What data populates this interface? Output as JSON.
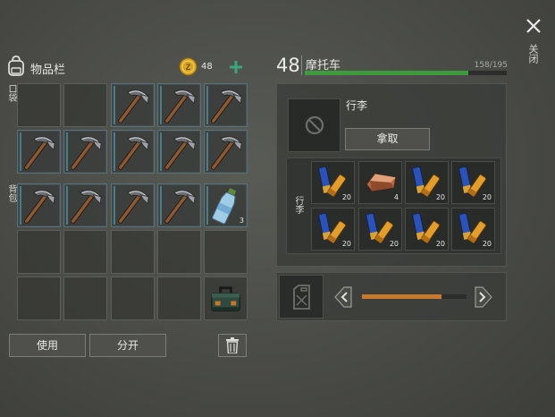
{
  "close": {
    "label": "关闭"
  },
  "inventory": {
    "title": "物品栏",
    "coins": "48",
    "pocket_label": "口袋",
    "backpack_label": "背包",
    "pocket_slots": [
      "",
      "",
      "pickaxe",
      "pickaxe",
      "pickaxe"
    ],
    "backpack_slots": [
      {
        "item": "pickaxe",
        "count": ""
      },
      {
        "item": "pickaxe",
        "count": ""
      },
      {
        "item": "pickaxe",
        "count": ""
      },
      {
        "item": "pickaxe",
        "count": ""
      },
      {
        "item": "pickaxe",
        "count": ""
      },
      {
        "item": "pickaxe",
        "count": ""
      },
      {
        "item": "pickaxe",
        "count": ""
      },
      {
        "item": "pickaxe",
        "count": ""
      },
      {
        "item": "pickaxe",
        "count": ""
      },
      {
        "item": "water-bottle",
        "count": "3"
      },
      {
        "item": "",
        "count": ""
      },
      {
        "item": "",
        "count": ""
      },
      {
        "item": "",
        "count": ""
      },
      {
        "item": "",
        "count": ""
      },
      {
        "item": "",
        "count": ""
      },
      {
        "item": "",
        "count": ""
      },
      {
        "item": "",
        "count": ""
      },
      {
        "item": "",
        "count": ""
      },
      {
        "item": "",
        "count": ""
      },
      {
        "item": "toolbox",
        "count": ""
      }
    ],
    "use_label": "使用",
    "split_label": "分开"
  },
  "vehicle": {
    "level": "48",
    "name": "摩托车",
    "durability": "158/195",
    "durability_fraction": 0.81,
    "luggage_title": "行李",
    "take_label": "拿取",
    "luggage_side_label": "行李",
    "items": [
      {
        "item": "shotgun-shells",
        "count": "20"
      },
      {
        "item": "copper-ingot",
        "count": "4"
      },
      {
        "item": "shotgun-shells",
        "count": "20"
      },
      {
        "item": "shotgun-shells",
        "count": "20"
      },
      {
        "item": "shotgun-shells",
        "count": "20"
      },
      {
        "item": "shotgun-shells",
        "count": "20"
      },
      {
        "item": "shotgun-shells",
        "count": "20"
      },
      {
        "item": "shotgun-shells",
        "count": "20"
      }
    ],
    "fuel_fraction": 0.76
  },
  "colors": {
    "accent_green": "#3f9a3e",
    "fuel_orange": "#c87a2a",
    "coin_gold": "#d8a520"
  }
}
